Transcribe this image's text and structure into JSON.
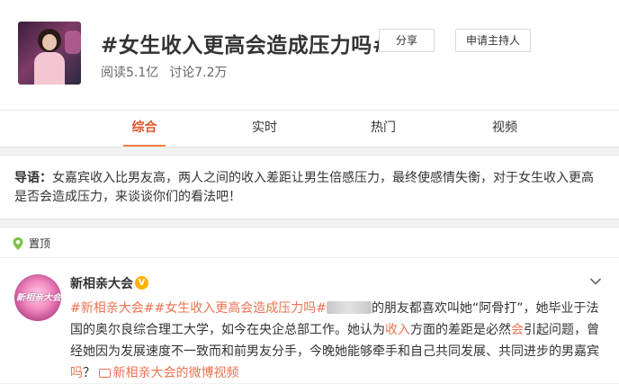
{
  "header": {
    "title": "#女生收入更高会造成压力吗#",
    "share_label": "分享",
    "apply_host_label": "申请主持人",
    "read_count": "阅读5.1亿",
    "discussion_count": "讨论7.2万"
  },
  "tabs": [
    {
      "label": "综合",
      "active": true
    },
    {
      "label": "实时",
      "active": false
    },
    {
      "label": "热门",
      "active": false
    },
    {
      "label": "视频",
      "active": false
    }
  ],
  "guide": {
    "prefix": "导语：",
    "text": "女嘉宾收入比男友高，两人之间的收入差距让男生倍感压力，最终使感情失衡，对于女生收入更高是否会造成压力，来谈谈你们的看法吧！"
  },
  "pinned": {
    "label": "置顶",
    "user": {
      "name": "新相亲大会",
      "avatar_text": "新相亲大会",
      "verified_mark": "V"
    },
    "post": {
      "tag1": "#新相亲大会#",
      "tag2": "#女生收入更高会造成压力吗#",
      "text1": "的朋友都喜欢叫她“阿骨打”，她毕业于法国的奥尔良综合理工大学，如今在央企总部工作。她认为",
      "highlight1": "收入",
      "text2": "方面的差距是必然",
      "highlight2": "会",
      "text3": "引起问题，曾经她因为发展速度不一致而和前男友分手，今晚她能够牵手和自己共同发展、共同进步的男嘉宾",
      "highlight3": "吗",
      "text4": "？",
      "video_link": "新相亲大会的微博视频"
    }
  },
  "colors": {
    "accent": "#eb7350",
    "active_tab": "#e0542b",
    "underline": "#ff8140",
    "verified": "#ffb100"
  }
}
